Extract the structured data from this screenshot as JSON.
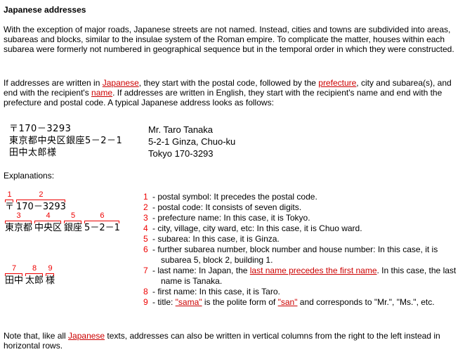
{
  "page": {
    "title": "Japanese addresses",
    "intro": "With the exception of major roads, Japanese streets are not named. Instead, cities and towns are subdivided into areas, subareas and blocks, similar to the insulae system of the Roman empire. To complicate the matter, houses within each subarea were formerly not numbered in geographical sequence but in the temporal order in which they were constructed.",
    "para2": {
      "t1": "If addresses are written in ",
      "link1": "Japanese",
      "t2": ", they start with the postal code, followed by the ",
      "link2": "prefecture",
      "t3": ", city and subarea(s), and end with the recipient's ",
      "link3": "name",
      "t4": ". If addresses are written in English, they start with the recipient's name and end with the prefecture and postal code. A typical Japanese address looks as follows:"
    },
    "address_jp": [
      "〒170－3293",
      "東京都中央区銀座5－2－1",
      "田中太郎様"
    ],
    "address_en": [
      "Mr. Taro Tanaka",
      "5-2-1 Ginza, Chuo-ku",
      "Tokyo 170-3293"
    ],
    "explanations_label": "Explanations:",
    "diagram": {
      "row1": [
        {
          "num": "1",
          "text": "〒"
        },
        {
          "num": "2",
          "text": "170－3293"
        }
      ],
      "row2": [
        {
          "num": "3",
          "text": "東京都"
        },
        {
          "num": "4",
          "text": "中央区"
        },
        {
          "num": "5",
          "text": "銀座"
        },
        {
          "num": "6",
          "text": "5－2－1"
        }
      ],
      "row3": [
        {
          "num": "7",
          "text": "田中"
        },
        {
          "num": "8",
          "text": "太郎"
        },
        {
          "num": "9",
          "text": "様"
        }
      ]
    },
    "explanations": [
      {
        "num": "1",
        "text": " - postal symbol: It precedes the postal code."
      },
      {
        "num": "2",
        "text": " - postal code: It consists of seven digits."
      },
      {
        "num": "3",
        "text": " - prefecture name: In this case, it is Tokyo."
      },
      {
        "num": "4",
        "text": " - city, village, city ward, etc: In this case, it is Chuo ward."
      },
      {
        "num": "5",
        "text": " - subarea: In this case, it is Ginza."
      },
      {
        "num": "6",
        "text": " - further subarea number, block number and house number: In this case, it is subarea 5, block 2, building 1."
      },
      {
        "num": "7",
        "t1": " - last name: In Japan, the ",
        "link": "last name precedes the first name",
        "t2": ". In this case, the last name is Tanaka."
      },
      {
        "num": "8",
        "text": " - first name: In this case, it is Taro."
      },
      {
        "num": "9",
        "t1": " - title: ",
        "link1": "\"sama\"",
        "t2": " is the polite form of ",
        "link2": "\"san\"",
        "t3": " and corresponds to \"Mr.\", \"Ms.\", etc."
      }
    ],
    "note": {
      "t1": "Note that, like all ",
      "link": "Japanese",
      "t2": " texts, addresses can also be written in vertical columns from the right to the left instead in horizontal rows."
    },
    "colors": {
      "link": "#cc0000",
      "annotation": "#ee0000",
      "text": "#000000"
    }
  }
}
